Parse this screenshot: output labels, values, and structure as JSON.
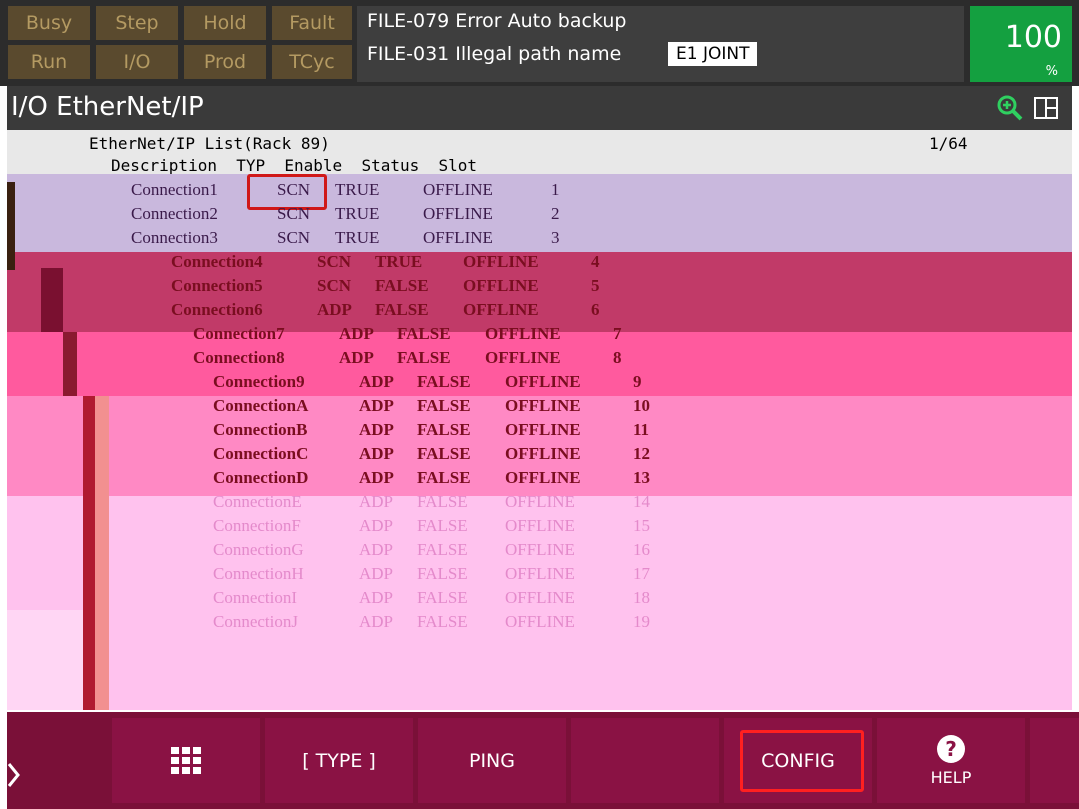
{
  "status_buttons": [
    {
      "label": "Busy"
    },
    {
      "label": "Step"
    },
    {
      "label": "Hold"
    },
    {
      "label": "Fault"
    },
    {
      "label": "Run"
    },
    {
      "label": "I/O"
    },
    {
      "label": "Prod"
    },
    {
      "label": "TCyc"
    }
  ],
  "alarms": {
    "line1": "FILE-079 Error Auto backup",
    "line2": "FILE-031 Illegal path name",
    "joint": "E1 JOINT"
  },
  "override": {
    "value": "100",
    "unit": "%"
  },
  "screen": {
    "title": "I/O EtherNet/IP"
  },
  "list": {
    "header": "EtherNet/IP List(Rack 89)",
    "page": "1/64",
    "columns": "Description  TYP  Enable  Status  Slot",
    "rows": [
      {
        "desc": "Connection1",
        "typ": "SCN",
        "enable": "TRUE",
        "status": "OFFLINE",
        "slot": "1"
      },
      {
        "desc": "Connection2",
        "typ": "SCN",
        "enable": "TRUE",
        "status": "OFFLINE",
        "slot": "2"
      },
      {
        "desc": "Connection3",
        "typ": "SCN",
        "enable": "TRUE",
        "status": "OFFLINE",
        "slot": "3"
      },
      {
        "desc": "Connection4",
        "typ": "SCN",
        "enable": "TRUE",
        "status": "OFFLINE",
        "slot": "4"
      },
      {
        "desc": "Connection5",
        "typ": "SCN",
        "enable": "FALSE",
        "status": "OFFLINE",
        "slot": "5"
      },
      {
        "desc": "Connection6",
        "typ": "ADP",
        "enable": "FALSE",
        "status": "OFFLINE",
        "slot": "6"
      },
      {
        "desc": "Connection7",
        "typ": "ADP",
        "enable": "FALSE",
        "status": "OFFLINE",
        "slot": "7"
      },
      {
        "desc": "Connection8",
        "typ": "ADP",
        "enable": "FALSE",
        "status": "OFFLINE",
        "slot": "8"
      },
      {
        "desc": "Connection9",
        "typ": "ADP",
        "enable": "FALSE",
        "status": "OFFLINE",
        "slot": "9"
      },
      {
        "desc": "ConnectionA",
        "typ": "ADP",
        "enable": "FALSE",
        "status": "OFFLINE",
        "slot": "10"
      },
      {
        "desc": "ConnectionB",
        "typ": "ADP",
        "enable": "FALSE",
        "status": "OFFLINE",
        "slot": "11"
      },
      {
        "desc": "ConnectionC",
        "typ": "ADP",
        "enable": "FALSE",
        "status": "OFFLINE",
        "slot": "12"
      },
      {
        "desc": "ConnectionD",
        "typ": "ADP",
        "enable": "FALSE",
        "status": "OFFLINE",
        "slot": "13"
      },
      {
        "desc": "ConnectionE",
        "typ": "ADP",
        "enable": "FALSE",
        "status": "OFFLINE",
        "slot": "14"
      },
      {
        "desc": "ConnectionF",
        "typ": "ADP",
        "enable": "FALSE",
        "status": "OFFLINE",
        "slot": "15"
      },
      {
        "desc": "ConnectionG",
        "typ": "ADP",
        "enable": "FALSE",
        "status": "OFFLINE",
        "slot": "16"
      },
      {
        "desc": "ConnectionH",
        "typ": "ADP",
        "enable": "FALSE",
        "status": "OFFLINE",
        "slot": "17"
      },
      {
        "desc": "ConnectionI",
        "typ": "ADP",
        "enable": "FALSE",
        "status": "OFFLINE",
        "slot": "18"
      },
      {
        "desc": "ConnectionJ",
        "typ": "ADP",
        "enable": "FALSE",
        "status": "OFFLINE",
        "slot": "19"
      }
    ]
  },
  "fkeys": {
    "type": "[ TYPE ]",
    "ping": "PING",
    "config": "CONFIG",
    "help": "HELP"
  },
  "icons": {
    "grid": "grid-menu-icon",
    "help": "question-circle-icon",
    "zoom": "zoom-in-icon",
    "layout": "split-screen-icon"
  },
  "colors": {
    "override_green": "#14a040",
    "fkey_bar": "#7a1038",
    "config_outline": "#ff2020",
    "selection_outline": "#d01818"
  }
}
